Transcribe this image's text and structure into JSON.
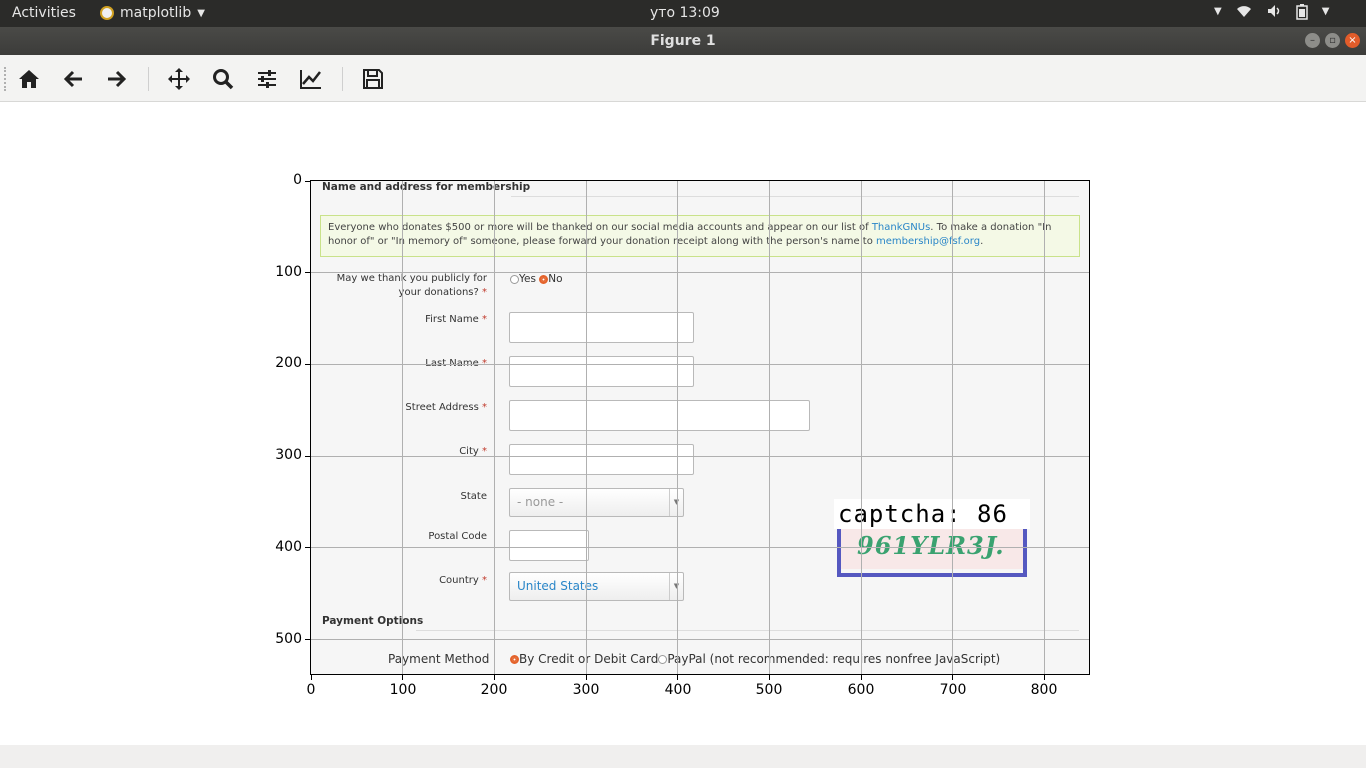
{
  "topbar": {
    "activities": "Activities",
    "app_name": "matplotlib",
    "clock": "уто 13:09"
  },
  "window": {
    "title": "Figure 1"
  },
  "toolbar": {
    "buttons": [
      "home-icon",
      "back-icon",
      "forward-icon",
      "pan-icon",
      "zoom-icon",
      "configure-subplots-icon",
      "edit-axis-icon",
      "save-icon"
    ]
  },
  "plot": {
    "x_ticks": [
      "0",
      "100",
      "200",
      "300",
      "400",
      "500",
      "600",
      "700",
      "800"
    ],
    "y_ticks": [
      "0",
      "100",
      "200",
      "300",
      "400",
      "500"
    ]
  },
  "form": {
    "section_title": "Name and address for membership",
    "notice_text_1": "Everyone who donates $500 or more will be thanked on our social media accounts and appear on our list of ",
    "notice_link_1": "ThankGNUs",
    "notice_text_2": ". To make a donation \"In honor of\" or \"In memory of\" someone, please forward your donation receipt along with the person's name to ",
    "notice_link_2": "membership@fsf.org",
    "notice_text_3": ".",
    "thank_question_1": "May we thank you publicly for",
    "thank_question_2": "your donations?",
    "required_mark": "*",
    "yes_label": "Yes",
    "no_label": "No",
    "first_name_label": "First Name",
    "last_name_label": "Last Name",
    "street_label": "Street Address",
    "city_label": "City",
    "state_label": "State",
    "state_value": "- none -",
    "postal_label": "Postal Code",
    "country_label": "Country",
    "country_value": "United States",
    "payment_section": "Payment Options",
    "payment_method_label": "Payment Method",
    "payment_option_card": "By Credit or Debit Card",
    "payment_option_paypal": "PayPal (not recommended: requires nonfree JavaScript)"
  },
  "captcha": {
    "label": "captcha: 86",
    "image_text": "961YLR3J."
  }
}
